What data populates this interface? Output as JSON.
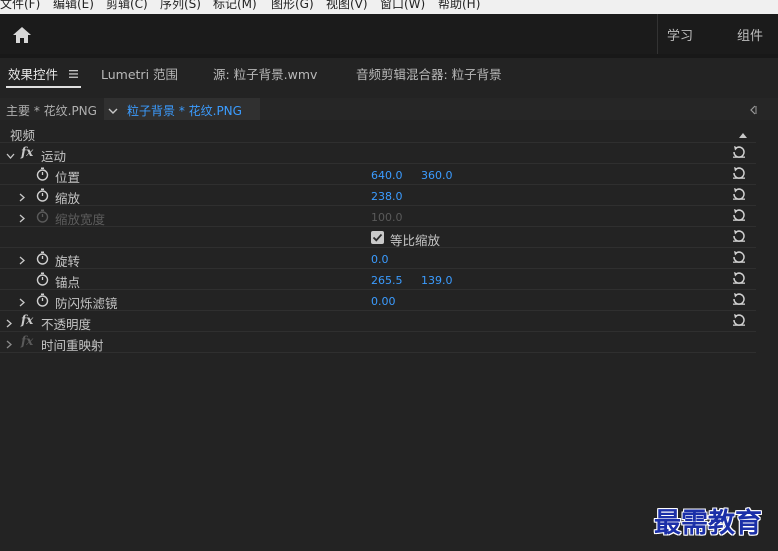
{
  "menu": {
    "items": [
      "文件(F)",
      "编辑(E)",
      "剪辑(C)",
      "序列(S)",
      "标记(M)",
      "图形(G)",
      "视图(V)",
      "窗口(W)",
      "帮助(H)"
    ]
  },
  "header": {
    "home_icon": "home-icon",
    "workspace_learn": "学习",
    "workspace_assembly": "组件"
  },
  "tabs": [
    {
      "label": "效果控件",
      "active": true
    },
    {
      "label": "Lumetri 范围",
      "active": false
    },
    {
      "label": "源: 粒子背景.wmv",
      "active": false
    },
    {
      "label": "音频剪辑混合器: 粒子背景",
      "active": false
    }
  ],
  "clip": {
    "master": "主要 * 花纹.PNG",
    "sequence": "粒子背景 * 花纹.PNG"
  },
  "section": {
    "video": "视频"
  },
  "effects": {
    "motion": "运动",
    "position": {
      "label": "位置",
      "x": "640.0",
      "y": "360.0"
    },
    "scale": {
      "label": "缩放",
      "value": "238.0"
    },
    "scale_width": {
      "label": "缩放宽度",
      "value": "100.0"
    },
    "uniform_scale": {
      "label": "等比缩放",
      "checked": true
    },
    "rotation": {
      "label": "旋转",
      "value": "0.0"
    },
    "anchor": {
      "label": "锚点",
      "x": "265.5",
      "y": "139.0"
    },
    "anti_flicker": {
      "label": "防闪烁滤镜",
      "value": "0.00"
    },
    "opacity": "不透明度",
    "time_remap": "时间重映射"
  },
  "fx_label": "fx",
  "watermark": "最需教育",
  "colors": {
    "accent": "#3b9cff",
    "background": "#232323",
    "watermark": "#1b2fa8"
  }
}
